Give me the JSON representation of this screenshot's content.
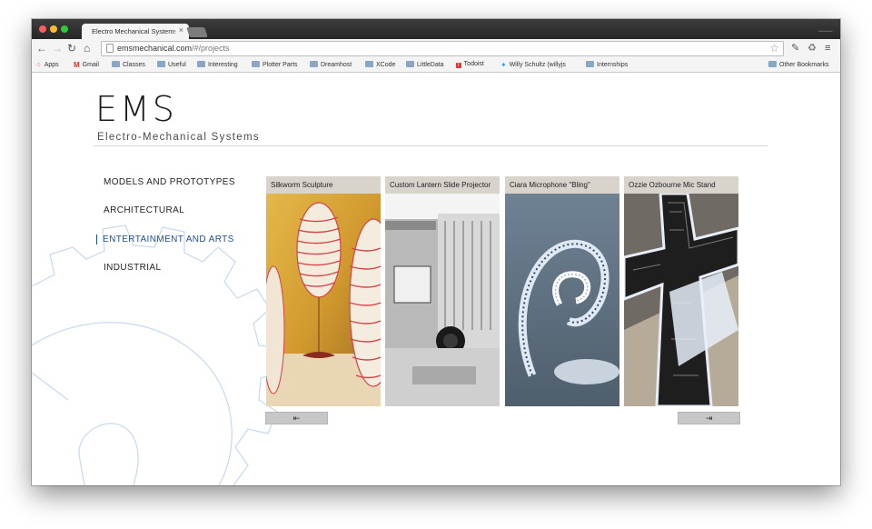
{
  "browser": {
    "tab_title": "Electro Mechanical Systems",
    "tab_close": "×",
    "url_host": "emsmechanical.com",
    "url_path": "/#/projects"
  },
  "bookmarks": [
    {
      "label": "Apps",
      "icon": "apps-grid-icon"
    },
    {
      "label": "Gmail",
      "icon": "gmail-icon"
    },
    {
      "label": "Classes",
      "icon": "folder-icon"
    },
    {
      "label": "Useful",
      "icon": "folder-icon"
    },
    {
      "label": "Interesting",
      "icon": "folder-icon"
    },
    {
      "label": "Plotter Parts",
      "icon": "folder-icon"
    },
    {
      "label": "Dreamhost",
      "icon": "folder-icon"
    },
    {
      "label": "XCode",
      "icon": "folder-icon"
    },
    {
      "label": "LittleData",
      "icon": "folder-icon"
    },
    {
      "label": "Todoist",
      "icon": "todoist-icon"
    },
    {
      "label": "Willy Schultz (willyjs",
      "icon": "twitter-icon"
    },
    {
      "label": "Internships",
      "icon": "folder-icon"
    },
    {
      "label": "Other Bookmarks",
      "icon": "folder-icon"
    }
  ],
  "site": {
    "logo": "EMS",
    "tagline": "Electro-Mechanical Systems",
    "accent_color": "#1f4f8e"
  },
  "categories": [
    {
      "label": "MODELS AND PROTOTYPES",
      "active": false
    },
    {
      "label": "ARCHITECTURAL",
      "active": false
    },
    {
      "label": "ENTERTAINMENT AND ARTS",
      "active": true
    },
    {
      "label": "INDUSTRIAL",
      "active": false
    }
  ],
  "projects": [
    {
      "title": "Silkworm Sculpture"
    },
    {
      "title": "Custom Lantern Slide Projector"
    },
    {
      "title": "Ciara Microphone \"Bling\""
    },
    {
      "title": "Ozzie Ozbourne Mic Stand"
    }
  ],
  "pager": {
    "prev": "⇤",
    "next": "⇥"
  }
}
